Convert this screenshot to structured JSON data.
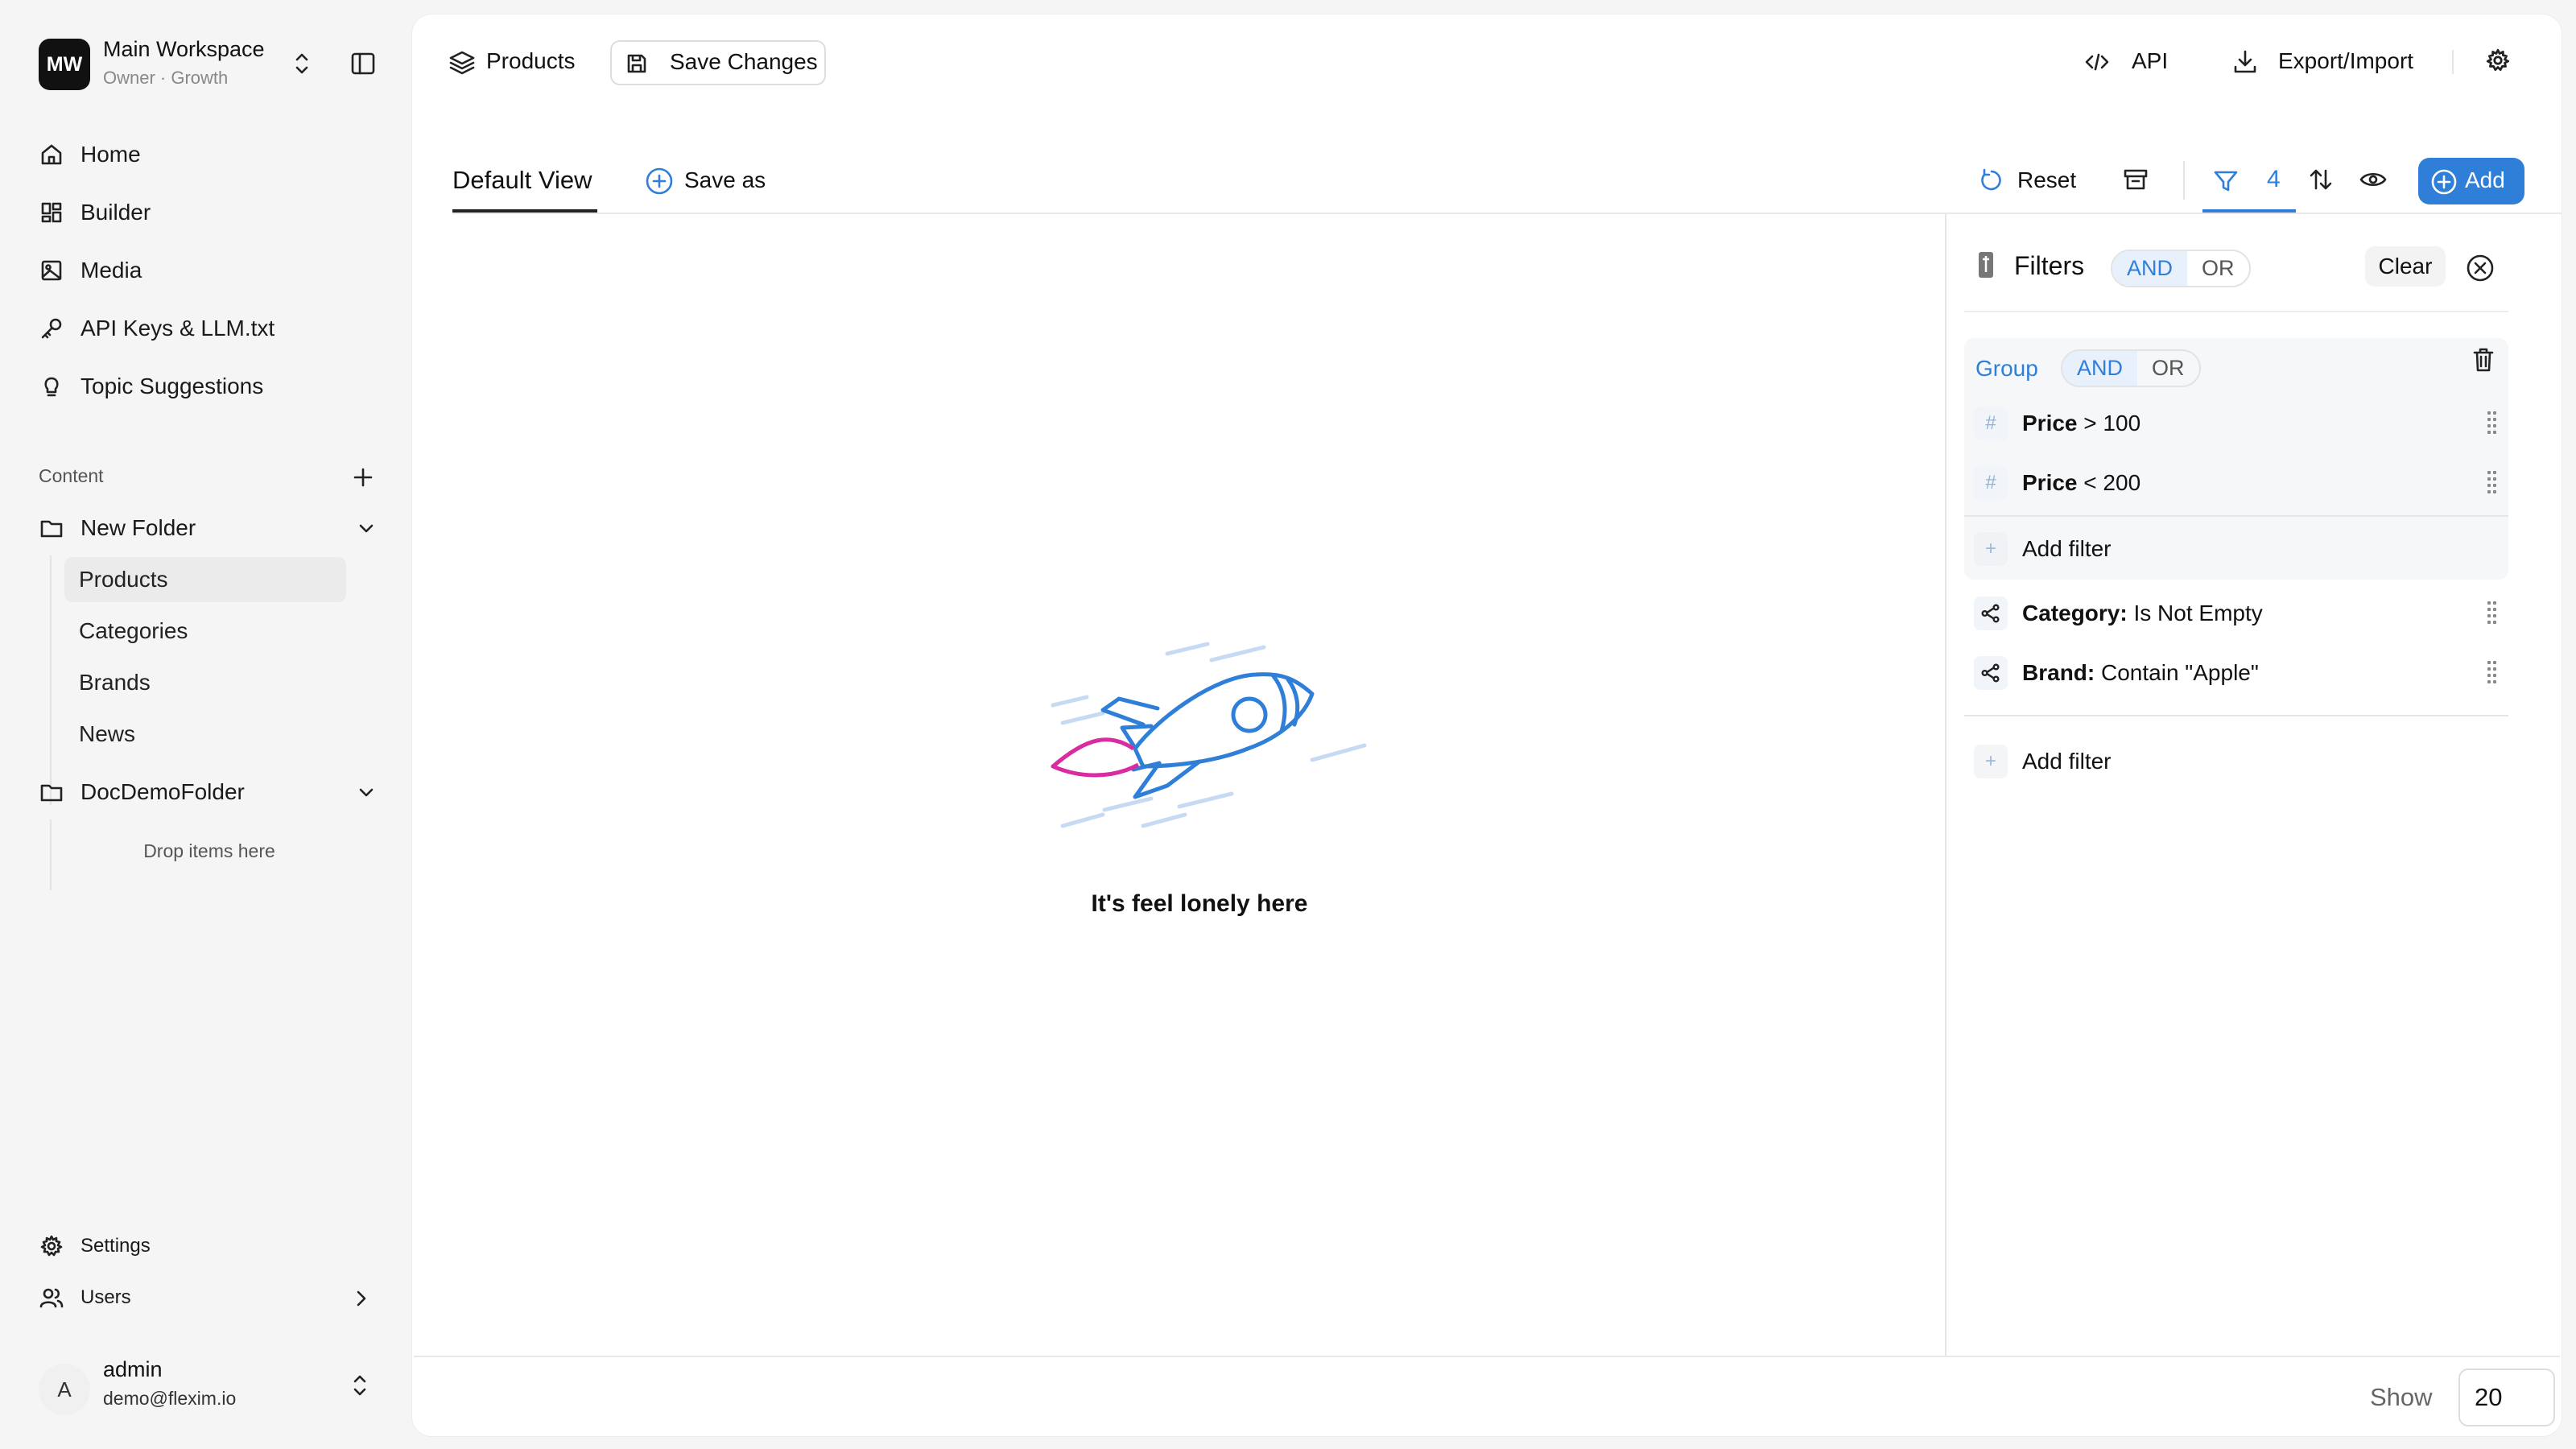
{
  "workspace": {
    "initials": "MW",
    "name": "Main Workspace",
    "role": "Owner · Growth"
  },
  "nav": {
    "home": "Home",
    "builder": "Builder",
    "media": "Media",
    "api_keys": "API Keys & LLM.txt",
    "topics": "Topic Suggestions"
  },
  "content": {
    "section_label": "Content",
    "folders": [
      {
        "name": "New Folder",
        "items": [
          "Products",
          "Categories",
          "Brands",
          "News"
        ]
      },
      {
        "name": "DocDemoFolder",
        "empty_hint": "Drop items here"
      }
    ]
  },
  "bottom_nav": {
    "settings": "Settings",
    "users": "Users"
  },
  "user": {
    "initial": "A",
    "name": "admin",
    "email": "demo@flexim.io"
  },
  "header": {
    "collection": "Products",
    "save_changes": "Save Changes",
    "api": "API",
    "export_import": "Export/Import"
  },
  "views": {
    "default_tab": "Default View",
    "save_as": "Save as",
    "reset": "Reset",
    "filter_count": "4",
    "add": "Add"
  },
  "empty_state": {
    "message": "It's feel lonely here"
  },
  "filters": {
    "title": "Filters",
    "and": "AND",
    "or": "OR",
    "clear": "Clear",
    "group": {
      "label": "Group",
      "and": "AND",
      "or": "OR",
      "conditions": [
        {
          "field": "Price",
          "op": " > ",
          "value": "100"
        },
        {
          "field": "Price",
          "op": " < ",
          "value": "200"
        }
      ],
      "add_filter": "Add filter"
    },
    "rules": [
      {
        "field": "Category:",
        "value": " Is Not Empty"
      },
      {
        "field": "Brand:",
        "value": " Contain \"Apple\""
      }
    ],
    "add_filter": "Add filter"
  },
  "pagination": {
    "show_label": "Show",
    "page_size": "20"
  },
  "colors": {
    "accent": "#2f7fd9",
    "rocket_flame": "#d92ca0"
  }
}
